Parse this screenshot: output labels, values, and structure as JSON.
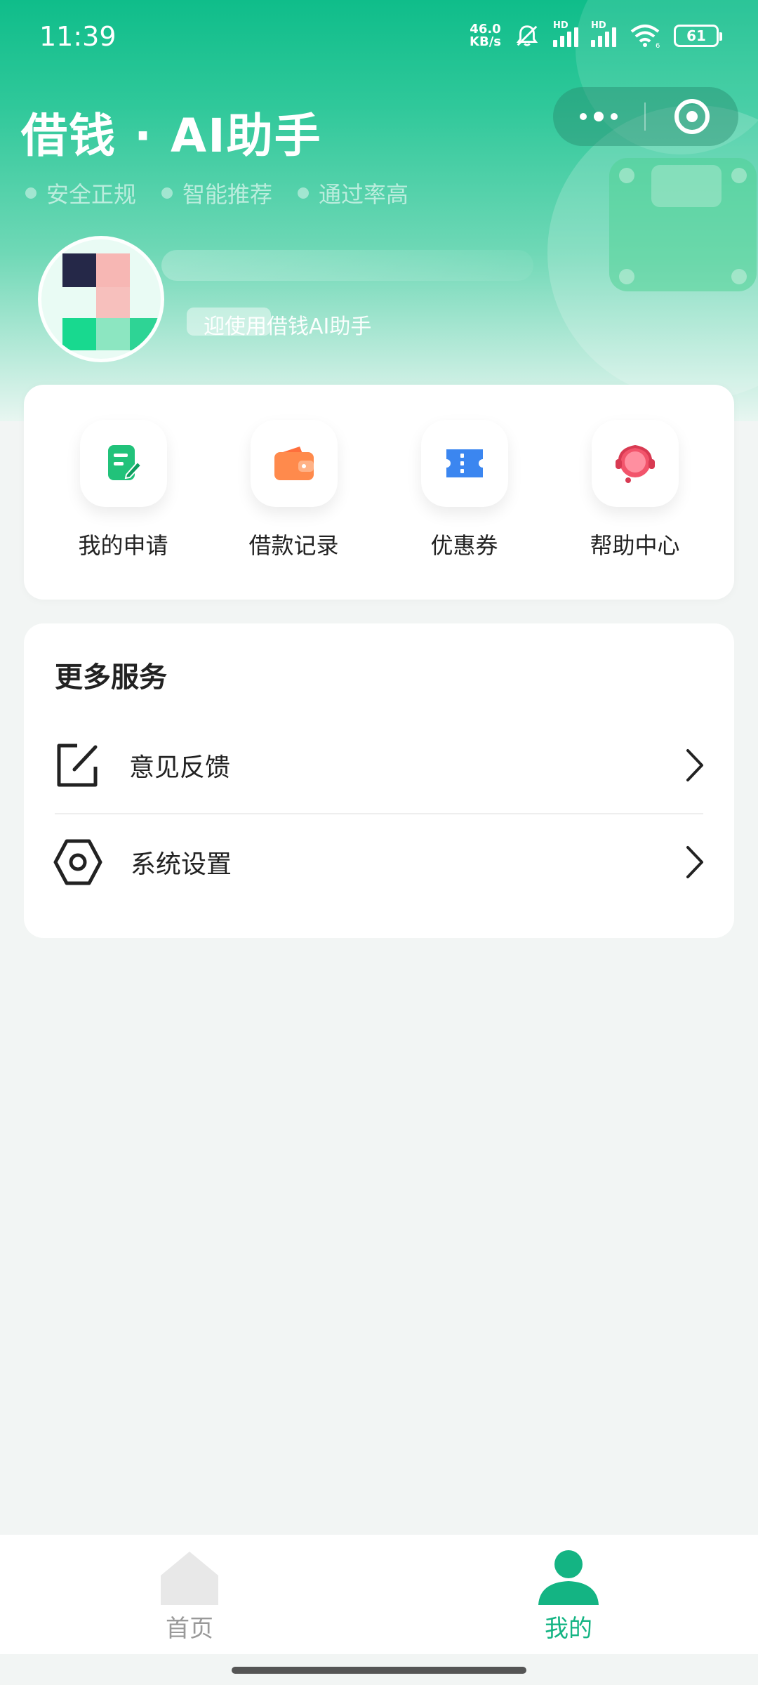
{
  "status_bar": {
    "time": "11:39",
    "net_speed_value": "46.0",
    "net_speed_unit": "KB/s",
    "signal_1_label": "HD",
    "signal_2_label": "HD",
    "wifi_label": "6",
    "battery": "61"
  },
  "header": {
    "title": "借钱 · AI助手",
    "tags": [
      "安全正规",
      "智能推荐",
      "通过率高"
    ]
  },
  "profile": {
    "welcome": "迎使用借钱AI助手"
  },
  "quick_actions": [
    {
      "label": "我的申请",
      "icon": "edit-note-icon",
      "color": "#21c27a"
    },
    {
      "label": "借款记录",
      "icon": "wallet-icon",
      "color": "#ff8a4c"
    },
    {
      "label": "优惠券",
      "icon": "ticket-icon",
      "color": "#3b86f0"
    },
    {
      "label": "帮助中心",
      "icon": "headset-icon",
      "color": "#f2546b"
    }
  ],
  "more_services": {
    "title": "更多服务",
    "items": [
      {
        "label": "意见反馈",
        "icon": "feedback-edit-icon"
      },
      {
        "label": "系统设置",
        "icon": "settings-hex-icon"
      }
    ]
  },
  "bottom_nav": {
    "home_label": "首页",
    "mine_label": "我的",
    "active_color": "#14b483",
    "inactive_color": "#999999"
  }
}
